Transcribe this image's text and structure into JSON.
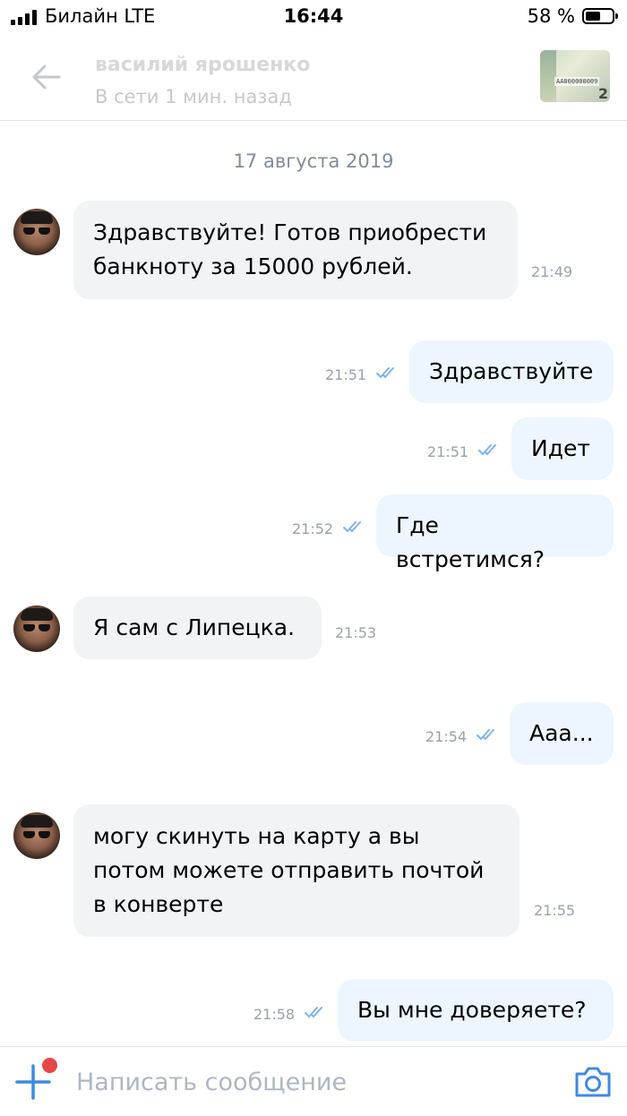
{
  "status_bar": {
    "carrier": "Билайн LTE",
    "time": "16:44",
    "battery_percent_label": "58 %",
    "battery_level": 0.58
  },
  "header": {
    "contact_name": "василий ярошенко",
    "contact_status": "В сети 1 мин. назад",
    "attachment_thumb": {
      "serial": "АА000000009",
      "digit": "2"
    },
    "accent_color": "#3f8ae0"
  },
  "chat": {
    "date_separator": "17 августа 2019",
    "messages": [
      {
        "direction": "in",
        "text": "Здравствуйте! Готов приобрести\nбанкноту за 15000 рублей.",
        "time": "21:49"
      },
      {
        "direction": "out",
        "text": "Здравствуйте",
        "time": "21:51",
        "read": true
      },
      {
        "direction": "out",
        "text": "Идет",
        "time": "21:51",
        "read": true
      },
      {
        "direction": "out",
        "text": "Где встретимся?",
        "time": "21:52",
        "read": true
      },
      {
        "direction": "in",
        "text": "Я сам с Липецка.",
        "time": "21:53"
      },
      {
        "direction": "out",
        "text": "Ааа...",
        "time": "21:54",
        "read": true
      },
      {
        "direction": "in",
        "text": "могу скинуть на карту а вы\nпотом можете отправить почтой\nв конверте",
        "time": "21:55"
      },
      {
        "direction": "out",
        "text": "Вы мне доверяете?",
        "time": "21:58",
        "read": true
      }
    ]
  },
  "composer": {
    "placeholder": "Написать сообщение",
    "value": "",
    "add_icon": "plus-icon",
    "camera_icon": "camera-icon"
  }
}
